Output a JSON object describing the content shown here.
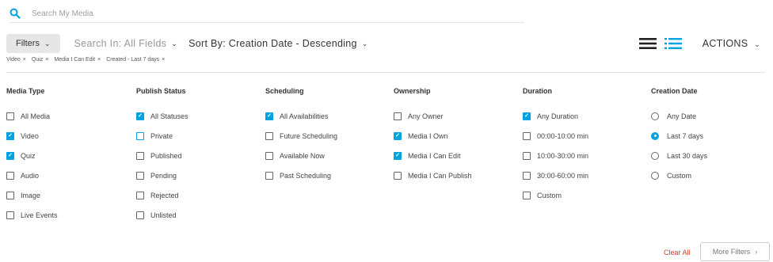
{
  "search": {
    "placeholder": "Search My Media",
    "icon": "search-icon"
  },
  "toolbar": {
    "filters_label": "Filters",
    "search_in_label": "Search In: All Fields",
    "sort_by_label": "Sort By: Creation Date - Descending",
    "actions_label": "ACTIONS",
    "view_modes": [
      "grid-view-icon",
      "list-view-icon"
    ],
    "accent_color": "#00a3e0"
  },
  "chips": [
    {
      "label": "Video"
    },
    {
      "label": "Quiz"
    },
    {
      "label": "Media I Can Edit"
    },
    {
      "label": "Created - Last 7 days"
    }
  ],
  "columns": [
    {
      "title": "Media Type",
      "type": "checkbox",
      "options": [
        {
          "label": "All Media",
          "checked": false
        },
        {
          "label": "Video",
          "checked": true
        },
        {
          "label": "Quiz",
          "checked": true
        },
        {
          "label": "Audio",
          "checked": false
        },
        {
          "label": "Image",
          "checked": false
        },
        {
          "label": "Live Events",
          "checked": false
        }
      ]
    },
    {
      "title": "Publish Status",
      "type": "checkbox",
      "options": [
        {
          "label": "All Statuses",
          "checked": true
        },
        {
          "label": "Private",
          "checked": false,
          "focused": true
        },
        {
          "label": "Published",
          "checked": false
        },
        {
          "label": "Pending",
          "checked": false
        },
        {
          "label": "Rejected",
          "checked": false
        },
        {
          "label": "Unlisted",
          "checked": false
        }
      ]
    },
    {
      "title": "Scheduling",
      "type": "checkbox",
      "options": [
        {
          "label": "All Availabilities",
          "checked": true
        },
        {
          "label": "Future Scheduling",
          "checked": false
        },
        {
          "label": "Available Now",
          "checked": false
        },
        {
          "label": "Past Scheduling",
          "checked": false
        }
      ]
    },
    {
      "title": "Ownership",
      "type": "checkbox",
      "options": [
        {
          "label": "Any Owner",
          "checked": false
        },
        {
          "label": "Media I Own",
          "checked": true
        },
        {
          "label": "Media I Can Edit",
          "checked": true
        },
        {
          "label": "Media I Can Publish",
          "checked": false
        }
      ]
    },
    {
      "title": "Duration",
      "type": "checkbox",
      "options": [
        {
          "label": "Any Duration",
          "checked": true
        },
        {
          "label": "00:00-10:00 min",
          "checked": false
        },
        {
          "label": "10:00-30:00 min",
          "checked": false
        },
        {
          "label": "30:00-60:00 min",
          "checked": false
        },
        {
          "label": "Custom",
          "checked": false
        }
      ]
    },
    {
      "title": "Creation Date",
      "type": "radio",
      "options": [
        {
          "label": "Any Date",
          "checked": false
        },
        {
          "label": "Last 7 days",
          "checked": true
        },
        {
          "label": "Last 30 days",
          "checked": false
        },
        {
          "label": "Custom",
          "checked": false
        }
      ]
    }
  ],
  "footer": {
    "clear_all_label": "Clear All",
    "more_filters_label": "More Filters",
    "clear_color": "#d8402e"
  }
}
